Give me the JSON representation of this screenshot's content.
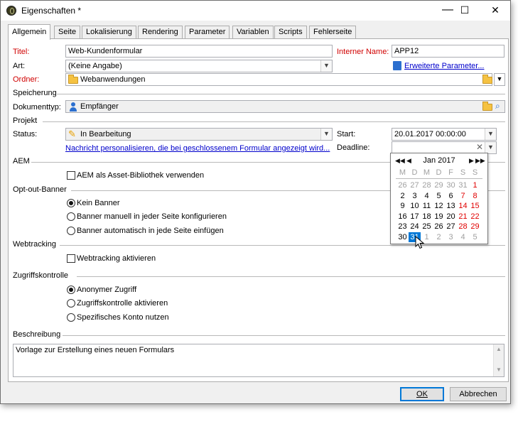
{
  "window": {
    "title": "Eigenschaften *",
    "min_glyph": "—",
    "max_glyph": "☐",
    "close_glyph": "✕"
  },
  "tabs": [
    "Allgemein",
    "Seite",
    "Lokalisierung",
    "Rendering",
    "Parameter",
    "Variablen",
    "Scripts",
    "Fehlerseite"
  ],
  "form": {
    "title_label": "Titel:",
    "title_value": "Web-Kundenformular",
    "internal_name_label": "Interner Name:",
    "internal_name_value": "APP12",
    "type_label": "Art:",
    "type_value": "(Keine Angabe)",
    "advanced_params_link": "Erweiterte Parameter...",
    "folder_label": "Ordner:",
    "folder_value": "Webanwendungen",
    "storage_section": "Speicherung",
    "doc_type_label": "Dokumenttyp:",
    "doc_type_value": "Empfänger",
    "project_section": "Projekt",
    "status_label": "Status:",
    "status_value": "In Bearbeitung",
    "start_label": "Start:",
    "start_value": "20.01.2017 00:00:00",
    "personalize_link": "Nachricht personalisieren, die bei geschlossenem Formular angezeigt wird...",
    "deadline_label": "Deadline:",
    "deadline_value": "",
    "aem_section": "AEM",
    "aem_checkbox_label": "AEM als Asset-Bibliothek verwenden",
    "optout_section": "Opt-out-Banner",
    "optout_options": [
      "Kein Banner",
      "Banner manuell in jeder Seite konfigurieren",
      "Banner automatisch in jede Seite einfügen"
    ],
    "webtracking_section": "Webtracking",
    "webtracking_checkbox_label": "Webtracking aktivieren",
    "access_section": "Zugriffskontrolle",
    "access_options": [
      "Anonymer Zugriff",
      "Zugriffskontrolle aktivieren",
      "Spezifisches Konto nutzen"
    ],
    "description_section": "Beschreibung",
    "description_value": "Vorlage zur Erstellung eines neuen Formulars"
  },
  "buttons": {
    "ok": "OK",
    "cancel": "Abbrechen"
  },
  "calendar": {
    "month_label": "Jan 2017",
    "weekdays": [
      "M",
      "D",
      "M",
      "D",
      "F",
      "S",
      "S"
    ],
    "selected_day": "31",
    "weeks": [
      [
        "26",
        "27",
        "28",
        "29",
        "30",
        "31",
        "1"
      ],
      [
        "2",
        "3",
        "4",
        "5",
        "6",
        "7",
        "8"
      ],
      [
        "9",
        "10",
        "11",
        "12",
        "13",
        "14",
        "15"
      ],
      [
        "16",
        "17",
        "18",
        "19",
        "20",
        "21",
        "22"
      ],
      [
        "23",
        "24",
        "25",
        "26",
        "27",
        "28",
        "29"
      ],
      [
        "30",
        "31",
        "1",
        "2",
        "3",
        "4",
        "5"
      ]
    ],
    "nav": {
      "prev_year": "◀◀",
      "prev_month": "◀",
      "next_month": "▶",
      "next_year": "▶▶"
    }
  },
  "colors": {
    "accent": "#0078d7",
    "required_label": "#d00000",
    "link": "#0000cc",
    "weekend": "#e00000"
  }
}
